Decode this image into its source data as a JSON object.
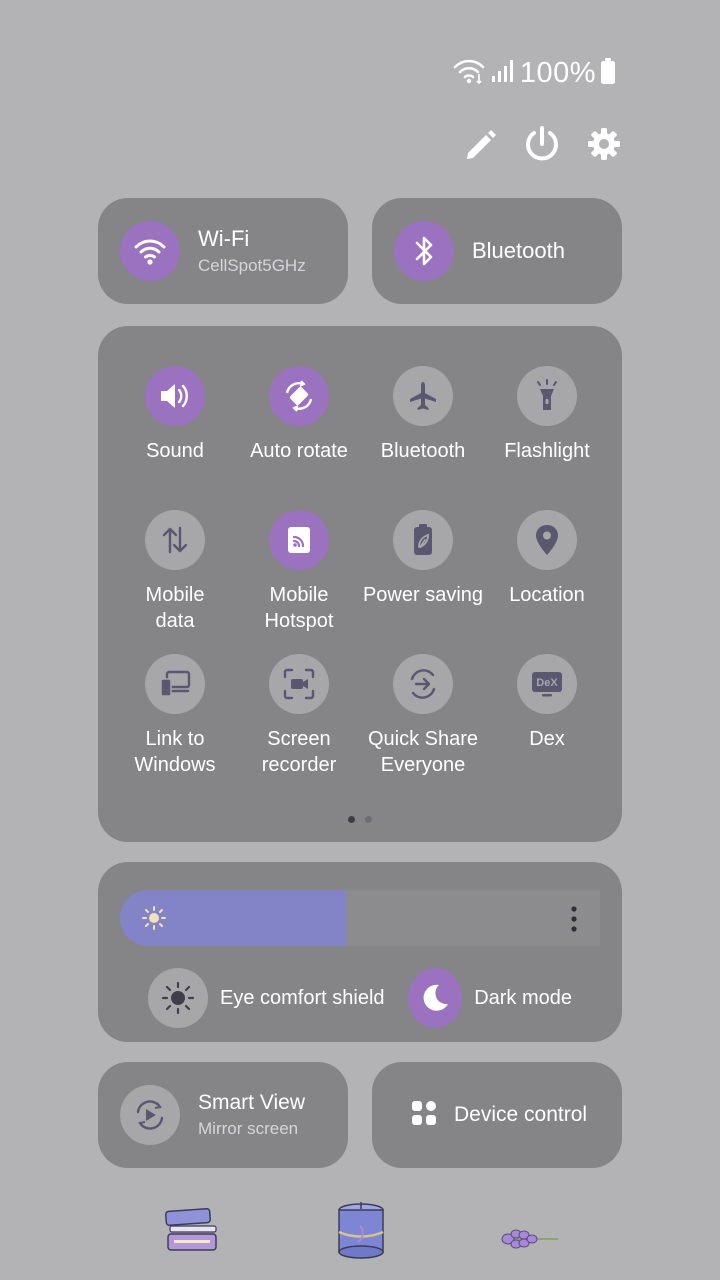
{
  "status": {
    "battery": "100%"
  },
  "top_tiles": {
    "wifi": {
      "title": "Wi-Fi",
      "subtitle": "CellSpot5GHz"
    },
    "bluetooth": {
      "title": "Bluetooth"
    }
  },
  "grid": {
    "sound": "Sound",
    "auto_rotate": "Auto rotate",
    "bluetooth": "Bluetooth",
    "flashlight": "Flashlight",
    "mobile_data": "Mobile\ndata",
    "mobile_hotspot": "Mobile\nHotspot",
    "power_saving": "Power saving",
    "location": "Location",
    "link_windows": "Link to\nWindows",
    "screen_recorder": "Screen\nrecorder",
    "quick_share": "Quick Share\nEveryone",
    "dex": "Dex",
    "dex_badge": "DeX",
    "page": {
      "current": 1,
      "total": 2
    }
  },
  "brightness": {
    "level": 0.47
  },
  "toggles": {
    "eye_comfort": "Eye comfort shield",
    "dark_mode": "Dark mode"
  },
  "bottom_tiles": {
    "smart_view": {
      "title": "Smart View",
      "subtitle": "Mirror screen"
    },
    "device_control": {
      "title": "Device control"
    }
  },
  "colors": {
    "accent": "#9a72c0",
    "brightness_fill": "#8284c7",
    "panel": "#858487",
    "background": "#b3b2b5"
  }
}
